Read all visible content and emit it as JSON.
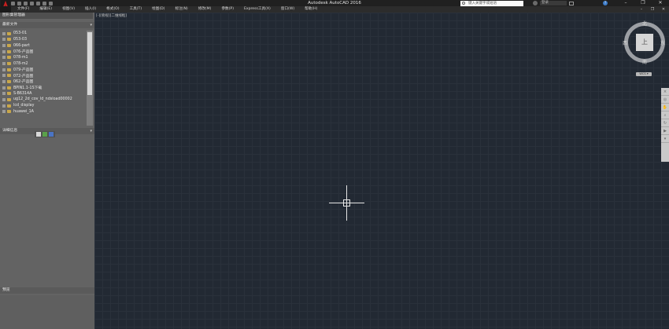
{
  "window": {
    "title": "Autodesk AutoCAD 2016",
    "search_placeholder": "键入关键字或短语",
    "sign_in": "登录"
  },
  "menu": [
    "文件(F)",
    "编辑(E)",
    "视图(V)",
    "插入(I)",
    "格式(O)",
    "工具(T)",
    "绘图(D)",
    "标注(N)",
    "修改(M)",
    "参数(P)",
    "Express工具(X)",
    "窗口(W)",
    "帮助(H)"
  ],
  "left_panel": {
    "title": "图形集管理器",
    "folders_header": "最新文件",
    "folders": [
      "053-01",
      "053-03",
      "066-part",
      "076-产品图",
      "078-m1",
      "078-m2",
      "079-产品图",
      "072-产品图",
      "062-产品图",
      "BPIN1.1-1S下载",
      "S-B6314A",
      "ug12_2d_cov_ld_ndsload00002",
      "lcd_display",
      "huawei_1A"
    ],
    "details_header": "详细信息",
    "preview_header": "预览"
  },
  "viewport": {
    "label": "[-][俯视][二维线框]"
  },
  "viewcube": {
    "top": "上",
    "north": "北",
    "south": "南",
    "east": "东",
    "west": "西",
    "wcs": "WCS ▾"
  },
  "colors": {
    "viewport_bg": "#222933",
    "panel_bg": "#636363",
    "accent": "#c81f1f"
  }
}
